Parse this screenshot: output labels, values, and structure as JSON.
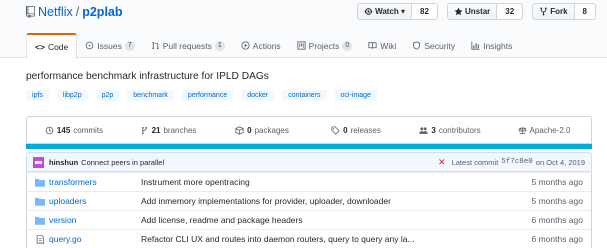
{
  "repo": {
    "owner": "Netflix",
    "separator": "/",
    "name": "p2plab"
  },
  "actions": {
    "watch": {
      "label": "Watch ▾",
      "count": "82"
    },
    "star": {
      "label": "Unstar",
      "count": "32"
    },
    "fork": {
      "label": "Fork",
      "count": "8"
    }
  },
  "tabs": [
    {
      "label": "Code",
      "icon": "code-icon"
    },
    {
      "label": "Issues",
      "badge": "7",
      "icon": "issue-icon"
    },
    {
      "label": "Pull requests",
      "badge": "1",
      "icon": "pull-request-icon"
    },
    {
      "label": "Actions",
      "icon": "play-icon"
    },
    {
      "label": "Projects",
      "badge": "0",
      "icon": "project-icon"
    },
    {
      "label": "Wiki",
      "icon": "book-icon"
    },
    {
      "label": "Security",
      "icon": "shield-icon"
    },
    {
      "label": "Insights",
      "icon": "graph-icon"
    }
  ],
  "description": "performance benchmark infrastructure for IPLD DAGs",
  "topics": [
    "ipfs",
    "libp2p",
    "p2p",
    "benchmark",
    "performance",
    "docker",
    "containers",
    "oci-image"
  ],
  "summary": {
    "commits": {
      "num": "145",
      "label": "commits"
    },
    "branches": {
      "num": "21",
      "label": "branches"
    },
    "packages": {
      "num": "0",
      "label": "packages"
    },
    "releases": {
      "num": "0",
      "label": "releases"
    },
    "contributors": {
      "num": "3",
      "label": "contributors"
    },
    "license": "Apache-2.0"
  },
  "colors": {
    "language_bar": "#00add8",
    "active_tab_border": "#e36209",
    "link": "#0366d6"
  },
  "commit": {
    "author": "hinshun",
    "message": "Connect peers in parallel",
    "status": "✕",
    "latest_label": "Latest commit",
    "sha": "5f7c8e0",
    "date": "on Oct 4, 2019"
  },
  "files": [
    {
      "type": "folder",
      "name": "transformers",
      "message": "Instrument more opentracing",
      "age": "5 months ago"
    },
    {
      "type": "folder",
      "name": "uploaders",
      "message": "Add inmemory implementations for provider, uploader, downloader",
      "age": "5 months ago"
    },
    {
      "type": "folder",
      "name": "version",
      "message": "Add license, readme and package headers",
      "age": "6 months ago"
    },
    {
      "type": "file",
      "name": "query.go",
      "message": "Refactor CLI UX and routes into daemon routers, query to query any la...",
      "age": "6 months ago"
    }
  ]
}
